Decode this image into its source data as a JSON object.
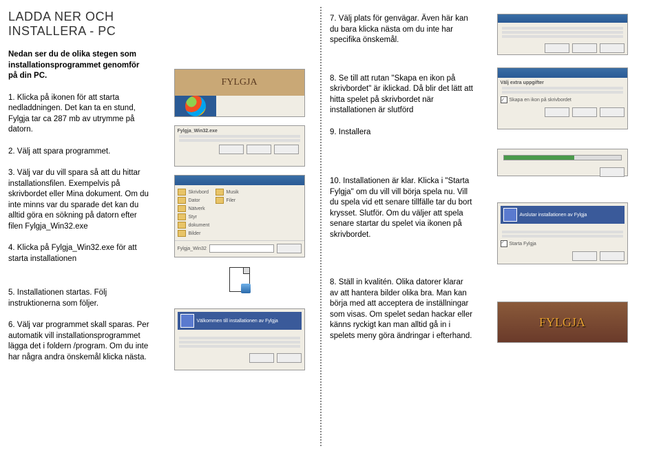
{
  "title": "LADDA NER OCH INSTALLERA - PC",
  "intro": "Nedan ser du de olika stegen som installationsprogrammet genomför på din PC.",
  "col1": {
    "p1": "1. Klicka på ikonen för att starta nedladdningen. Det kan ta en stund, Fylgja tar ca 287 mb av utrymme på datorn.",
    "p2": "2. Välj att spara programmet.",
    "p3": "3. Välj var du vill spara så att du hittar installationsfilen. Exempelvis på skrivbordet eller Mina dokument. Om du inte minns var du sparade det kan du alltid göra en sökning på datorn efter filen Fylgja_Win32.exe",
    "p4": "4. Klicka på Fylgja_Win32.exe för att starta installationen",
    "p5": "5. Installationen startas. Följ instruktionerna som följer.",
    "p6": "6. Välj var programmet skall sparas. Per automatik vill installationsprogrammet lägga det i foldern /program. Om du inte har några andra önskemål klicka nästa."
  },
  "col3": {
    "p7": "7. Välj plats för genvägar. Även här kan du bara klicka nästa om du inte har specifika önskemål.",
    "p8": "8. Se till att rutan \"Skapa en ikon på skrivbordet\" är iklickad. Då blir det lätt att hitta spelet på skrivbordet när installationen är slutförd",
    "p9": "9. Installera",
    "p10": "10. Installationen är klar. Klicka i \"Starta Fylgja\" om du vill vill börja spela nu. Vill du spela vid ett senare tillfälle tar du bort krysset. Slutför. Om du väljer att spela senare startar du spelet via ikonen på skrivbordet.",
    "p11": "8. Ställ in kvalitén. Olika datorer klarar av att hantera bilder olika bra. Man kan börja med att acceptera de inställningar som visas. Om spelet sedan hackar eller känns ryckigt kan man alltid gå in i spelets meny göra ändringar i efterhand."
  },
  "thumbs": {
    "logo_text": "FYLGJA",
    "windows_label": "Windows",
    "download_file": "Fylgja_Win32.exe",
    "folders": [
      "Skrivbord",
      "Dator",
      "Nätverk",
      "Styr",
      "dokument",
      "Bilder",
      "Musik",
      "Filer"
    ],
    "file_label": "Fylgja_Win32",
    "installer_title": "Välkommen till installationen av Fylgja",
    "finish_title": "Avslutar installationen av Fylgja",
    "checkbox_label": "Starta Fylgja"
  }
}
